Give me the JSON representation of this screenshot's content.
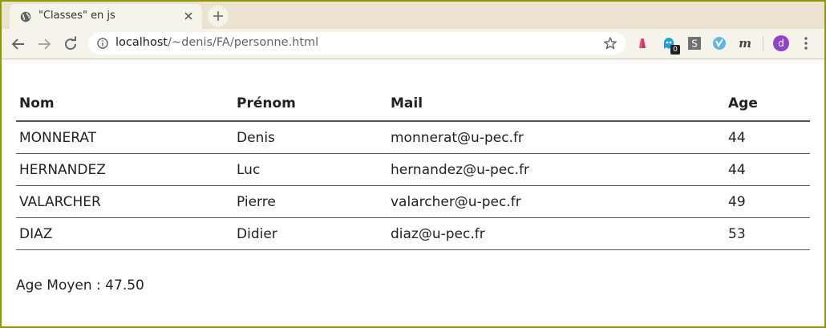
{
  "browser": {
    "tab_title": "\"Classes\" en js",
    "url_host": "localhost",
    "url_path": "/~denis/FA/personne.html",
    "extension_badge": "0",
    "avatar_letter": "d",
    "accent_color": "#8f9a00"
  },
  "table": {
    "headers": [
      "Nom",
      "Prénom",
      "Mail",
      "Age"
    ],
    "rows": [
      [
        "MONNERAT",
        "Denis",
        "monnerat@u-pec.fr",
        "44"
      ],
      [
        "HERNANDEZ",
        "Luc",
        "hernandez@u-pec.fr",
        "44"
      ],
      [
        "VALARCHER",
        "Pierre",
        "valarcher@u-pec.fr",
        "49"
      ],
      [
        "DIAZ",
        "Didier",
        "diaz@u-pec.fr",
        "53"
      ]
    ]
  },
  "summary": {
    "average_label": "Age Moyen : 47.50"
  }
}
